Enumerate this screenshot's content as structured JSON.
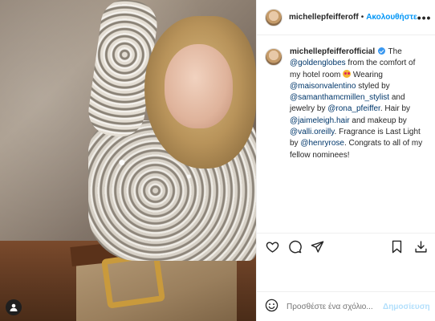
{
  "post": {
    "author": "michellepfeifferoff",
    "dot": "•",
    "follow_label": "Ακολουθήστε",
    "more_label": "•••"
  },
  "caption": {
    "user": "michellepfeifferofficial",
    "segments": {
      "s1": "The ",
      "m1": "@goldenglobes",
      "s2": " from the comfort of my hotel room ",
      "s3": " Wearing ",
      "m2": "@maisonvalentino",
      "s4": " styled by ",
      "m3": "@samanthamcmillen_stylist",
      "s5": " and jewelry by ",
      "m4": "@rona_pfeiffer",
      "s6": ". Hair by ",
      "m5": "@jaimeleigh.hair",
      "s7": " and makeup by ",
      "m6": "@valli.oreilly",
      "s8": ". Fragrance is Last Light by ",
      "m7": "@henryrose",
      "s9": ". Congrats to all of my fellow nominees!"
    }
  },
  "comment": {
    "placeholder": "Προσθέστε ένα σχόλιο...",
    "post_label": "Δημοσίευση"
  },
  "colors": {
    "accent": "#0095f6",
    "mention": "#00376b",
    "post_disabled": "#b2dffc"
  }
}
